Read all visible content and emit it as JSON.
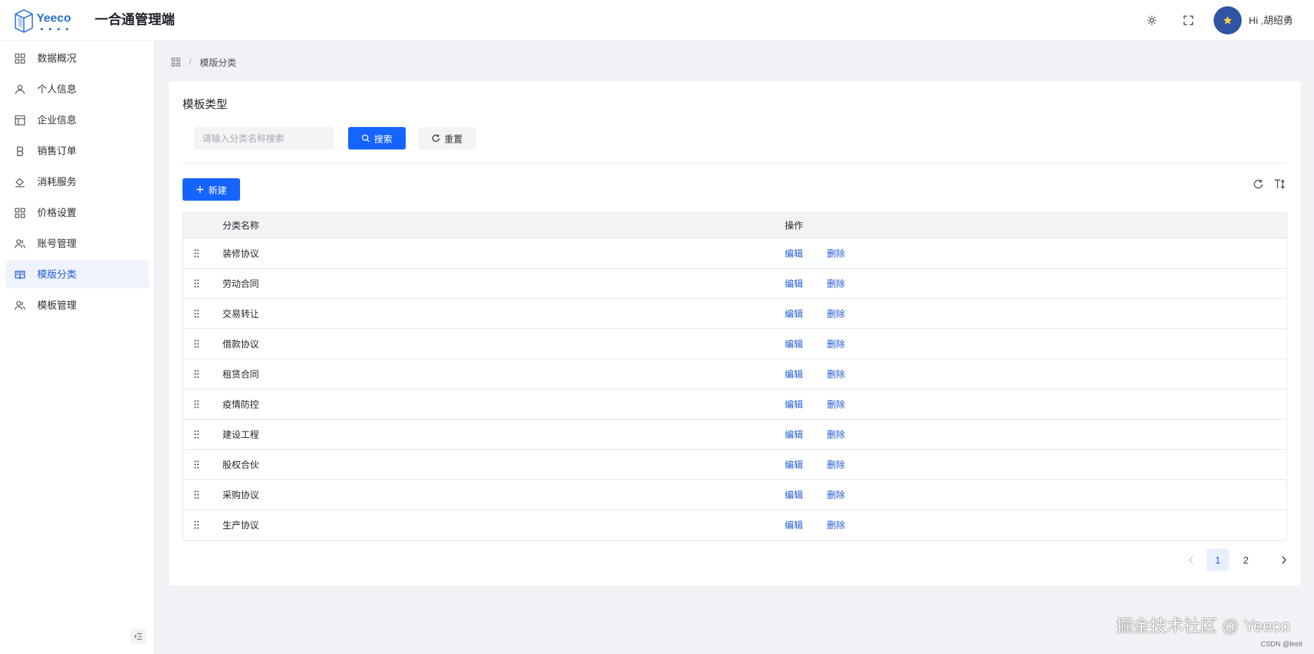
{
  "header": {
    "logo_alt": "Yeeco",
    "app_title": "一合通管理端",
    "greeting": "Hi ,胡绍勇",
    "icons": [
      "sun-icon",
      "fullscreen-icon"
    ]
  },
  "sidebar": {
    "items": [
      {
        "label": "数据概况",
        "icon": "grid-icon",
        "active": false
      },
      {
        "label": "个人信息",
        "icon": "user-icon",
        "active": false
      },
      {
        "label": "企业信息",
        "icon": "layout-icon",
        "active": false
      },
      {
        "label": "销售订单",
        "icon": "bold-b-icon",
        "active": false
      },
      {
        "label": "消耗服务",
        "icon": "fill-bucket-icon",
        "active": false
      },
      {
        "label": "价格设置",
        "icon": "grid-icon",
        "active": false
      },
      {
        "label": "账号管理",
        "icon": "users-icon",
        "active": false
      },
      {
        "label": "模版分类",
        "icon": "book-icon",
        "active": true
      },
      {
        "label": "模板管理",
        "icon": "users-icon",
        "active": false
      }
    ]
  },
  "breadcrumb": {
    "separator": "/",
    "current": "模版分类"
  },
  "card": {
    "title": "模板类型",
    "search": {
      "placeholder": "请输入分类名称搜索",
      "value": ""
    },
    "search_button": "搜索",
    "reset_button": "重置",
    "new_button": "新建"
  },
  "table": {
    "columns": [
      "分类名称",
      "操作"
    ],
    "edit_label": "编辑",
    "delete_label": "删除",
    "rows": [
      {
        "name": "装修协议"
      },
      {
        "name": "劳动合同"
      },
      {
        "name": "交易转让"
      },
      {
        "name": "借款协议"
      },
      {
        "name": "租赁合同"
      },
      {
        "name": "疫情防控"
      },
      {
        "name": "建设工程"
      },
      {
        "name": "股权合伙"
      },
      {
        "name": "采购协议"
      },
      {
        "name": "生产协议"
      }
    ]
  },
  "pagination": {
    "pages": [
      "1",
      "2"
    ],
    "current": "1"
  },
  "footer": {
    "watermark": "掘金技术社区 @ Yeeco",
    "csdn": "CSDN @leeit"
  },
  "colors": {
    "primary": "#1664ff",
    "link": "#1f5bd6",
    "active_bg": "#eef3fd"
  }
}
